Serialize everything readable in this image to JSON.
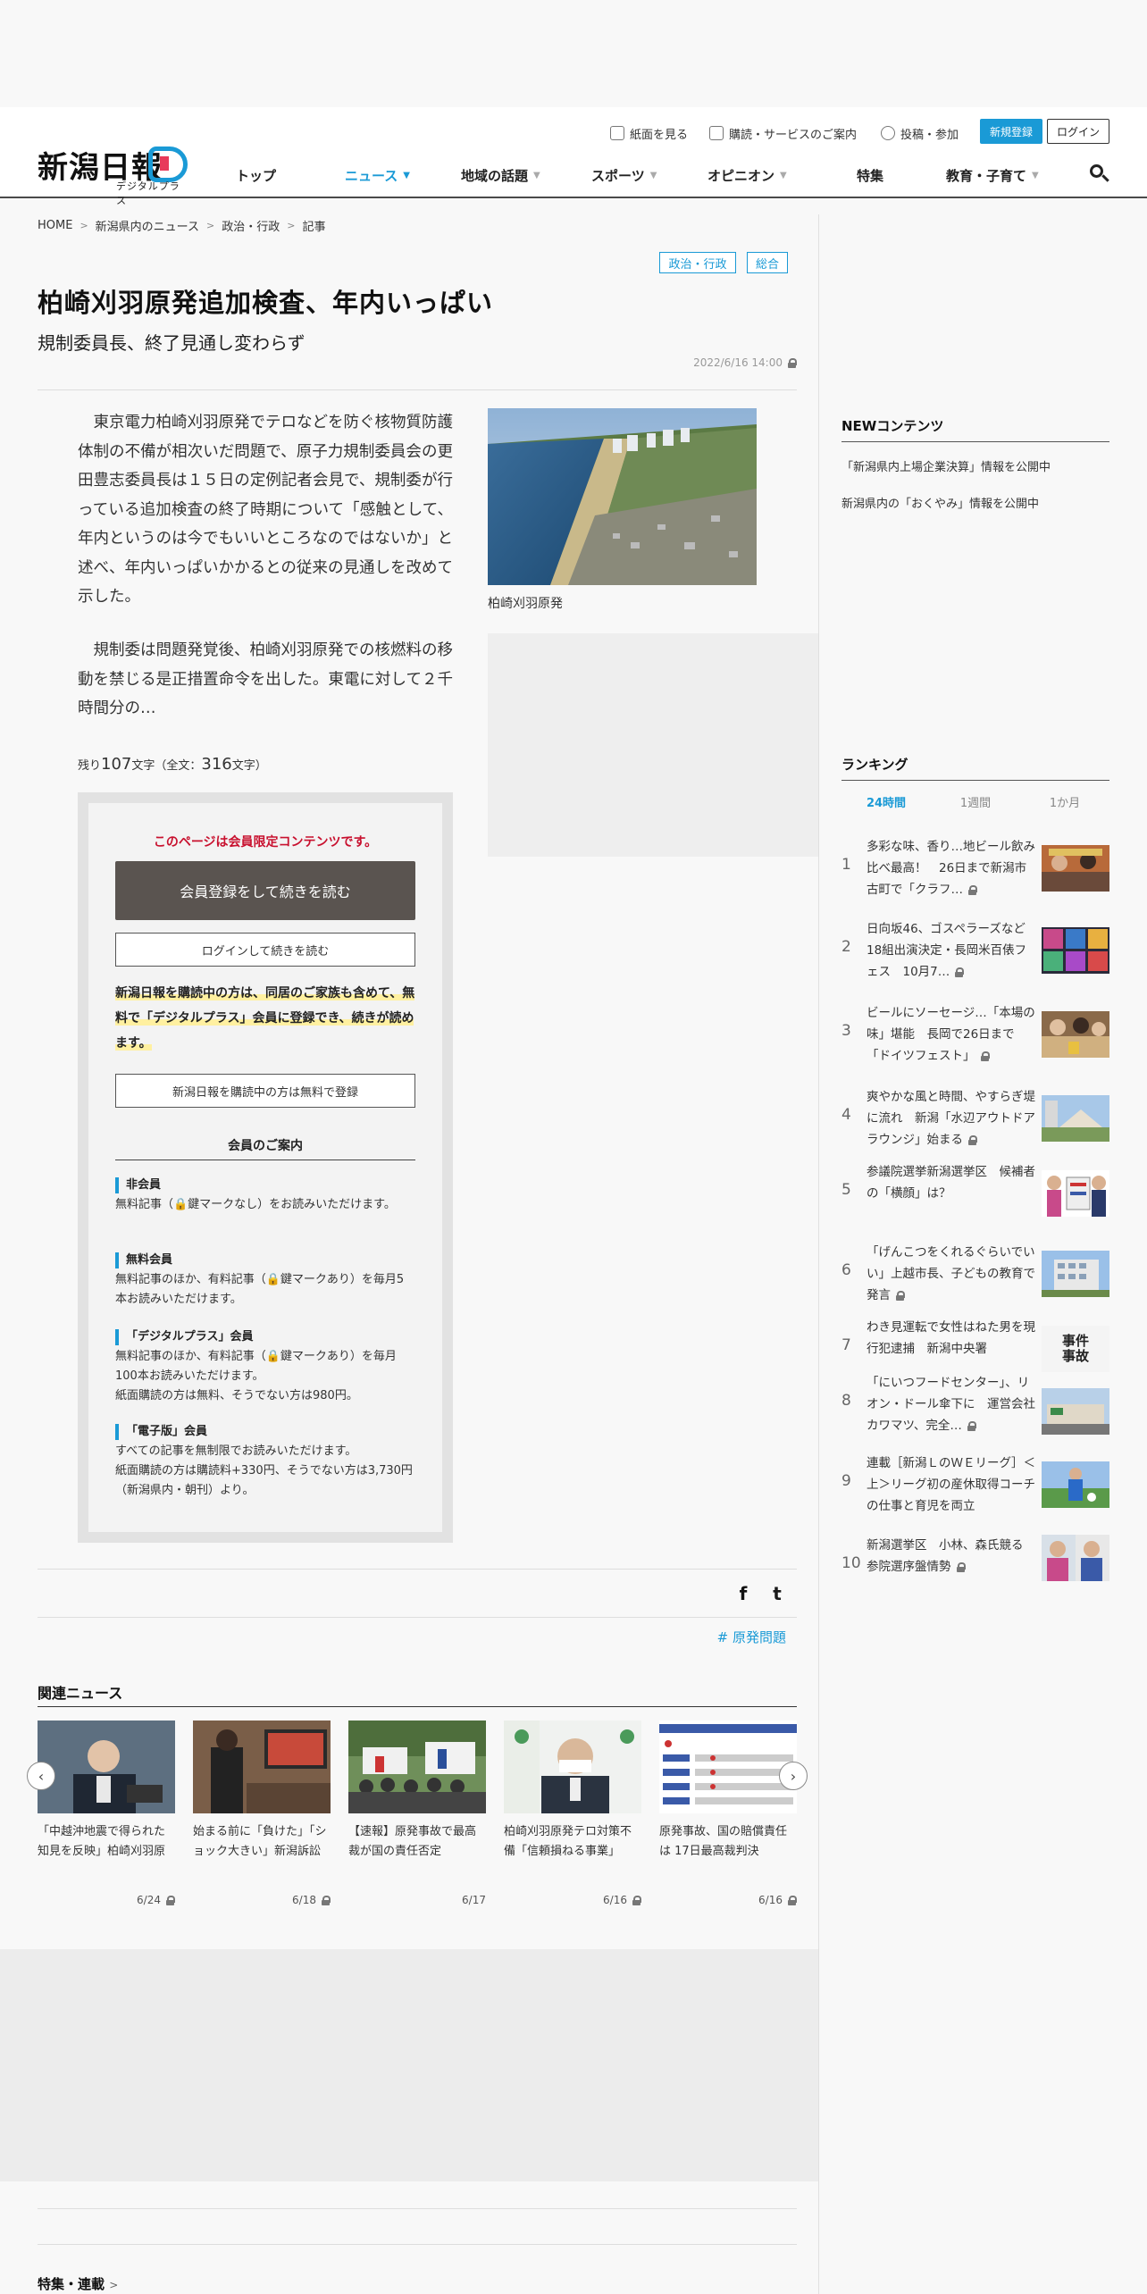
{
  "header": {
    "logo_text": "新潟日報",
    "logo_sub": "デジタルプラス",
    "util": [
      {
        "label": "紙面を見る",
        "icon": "newspaper-icon"
      },
      {
        "label": "購読・サービスのご案内",
        "icon": "box-icon"
      },
      {
        "label": "投稿・参加",
        "icon": "comment-icon"
      }
    ],
    "register_label": "新規登録",
    "login_label": "ログイン",
    "nav": [
      {
        "label": "トップ",
        "caret": false
      },
      {
        "label": "ニュース",
        "caret": true,
        "active": true
      },
      {
        "label": "地域の話題",
        "caret": true
      },
      {
        "label": "スポーツ",
        "caret": true
      },
      {
        "label": "オピニオン",
        "caret": true
      },
      {
        "label": "特集",
        "caret": false
      },
      {
        "label": "教育・子育て",
        "caret": true
      }
    ],
    "caret_glyph": "▼"
  },
  "breadcrumb": [
    "HOME",
    "新潟県内のニュース",
    "政治・行政",
    "記事"
  ],
  "breadcrumb_sep": ">",
  "tags": [
    "政治・行政",
    "総合"
  ],
  "article": {
    "title": "柏崎刈羽原発追加検査、年内いっぱい",
    "subtitle": "規制委員長、終了見通し変わらず",
    "date": "2022/6/16 14:00",
    "p1": "東京電力柏崎刈羽原発でテロなどを防ぐ核物質防護体制の不備が相次いだ問題で、原子力規制委員会の更田豊志委員長は１５日の定例記者会見で、規制委が行っている追加検査の終了時期について「感触として、年内というのは今でもいいところなのではないか」と述べ、年内いっぱいかかるとの従来の見通しを改めて示した。",
    "p2": "規制委は問題発覚後、柏崎刈羽原発での核燃料の移動を禁じる是正措置命令を出した。東電に対して２千時間分の…",
    "photo_caption": "柏崎刈羽原発",
    "remain_prefix": "残り",
    "remain_count": "107",
    "remain_mid": "文字（全文：",
    "total_count": "316",
    "remain_suffix": "文字）"
  },
  "paywall": {
    "heading": "このページは会員限定コンテンツです。",
    "primary_button": "会員登録をして続きを読む",
    "login_button": "ログインして続きを読む",
    "note": "新潟日報を購読中の方は、同居のご家族も含めて、無料で「デジタルプラス」会員に登録でき、続きが読めます。",
    "subscriber_button": "新潟日報を購読中の方は無料で登録",
    "guide_title": "会員のご案内",
    "tiers": [
      {
        "name": "非会員",
        "lines": [
          "無料記事（🔒鍵マークなし）をお読みいただけます。"
        ]
      },
      {
        "name": "無料会員",
        "lines": [
          "無料記事のほか、有料記事（🔒鍵マークあり）を毎月5本お読みいただけます。"
        ]
      },
      {
        "name": "「デジタルプラス」会員",
        "lines": [
          "無料記事のほか、有料記事（🔒鍵マークあり）を毎月100本お読みいただけます。",
          "紙面購読の方は無料、そうでない方は980円。"
        ]
      },
      {
        "name": "「電子版」会員",
        "lines": [
          "すべての記事を無制限でお読みいただけます。",
          "紙面購読の方は購読料+330円、そうでない方は3,730円（新潟県内・朝刊）より。"
        ]
      }
    ]
  },
  "share": {
    "facebook": "f",
    "twitter": "t"
  },
  "topic_tag": "# 原発問題",
  "related": {
    "title": "関連ニュース",
    "items": [
      {
        "title": "「中越沖地震で得られた知見を反映」柏崎刈羽原発・稲垣武之所長",
        "date": "6/24",
        "locked": true
      },
      {
        "title": "始まる前に「負けた」「ショック大きい」新潟訴訟の原告は落胆と怒り",
        "date": "6/18",
        "locked": true
      },
      {
        "title": "【速報】原発事故で最高裁が国の責任否定",
        "date": "6/17",
        "locked": false
      },
      {
        "title": "柏崎刈羽原発テロ対策不備「信頼損ねる事業」",
        "date": "6/16",
        "locked": true
      },
      {
        "title": "原発事故、国の賠償責任は 17日最高裁判決",
        "date": "6/16",
        "locked": true
      }
    ],
    "prev": "‹",
    "next": "›"
  },
  "feature_link": "特集・連載",
  "sidebar": {
    "new_title": "NEWコンテンツ",
    "new_items": [
      "「新潟県内上場企業決算」情報を公開中",
      "新潟県内の「おくやみ」情報を公開中"
    ],
    "ranking_title": "ランキング",
    "ranking_tabs": [
      "24時間",
      "1週間",
      "1か月"
    ],
    "ranking": [
      {
        "rank": "1",
        "title": "多彩な味、香り…地ビール飲み比べ最高！　26日まで新潟市古町で「クラフ…",
        "locked": true
      },
      {
        "rank": "2",
        "title": "日向坂46、ゴスペラーズなど18組出演決定・長岡米百俵フェス　10月7…",
        "locked": true
      },
      {
        "rank": "3",
        "title": "ビールにソーセージ…「本場の味」堪能　長岡で26日まで「ドイツフェスト」",
        "locked": true
      },
      {
        "rank": "4",
        "title": "爽やかな風と時間、やすらぎ堤に流れ　新潟「水辺アウトドアラウンジ」始まる",
        "locked": true
      },
      {
        "rank": "5",
        "title": "参議院選挙新潟選挙区　候補者の「横顔」は？",
        "locked": false
      },
      {
        "rank": "6",
        "title": "「げんこつをくれるぐらいでいい」上越市長、子どもの教育で発言",
        "locked": true
      },
      {
        "rank": "7",
        "title": "わき見運転で女性はねた男を現行犯逮捕　新潟中央署",
        "locked": false
      },
      {
        "rank": "8",
        "title": "「にいつフードセンター」、リオン・ドール傘下に　運営会社カワマツ、完全…",
        "locked": true
      },
      {
        "rank": "9",
        "title": "連載［新潟ＬのＷＥリーグ］＜上＞リーグ初の産休取得コーチの仕事と育児を両立",
        "locked": false
      },
      {
        "rank": "10",
        "title": "新潟選挙区　小林、森氏競る　参院選序盤情勢",
        "locked": true
      }
    ],
    "thumb7_text": "事件事故"
  }
}
